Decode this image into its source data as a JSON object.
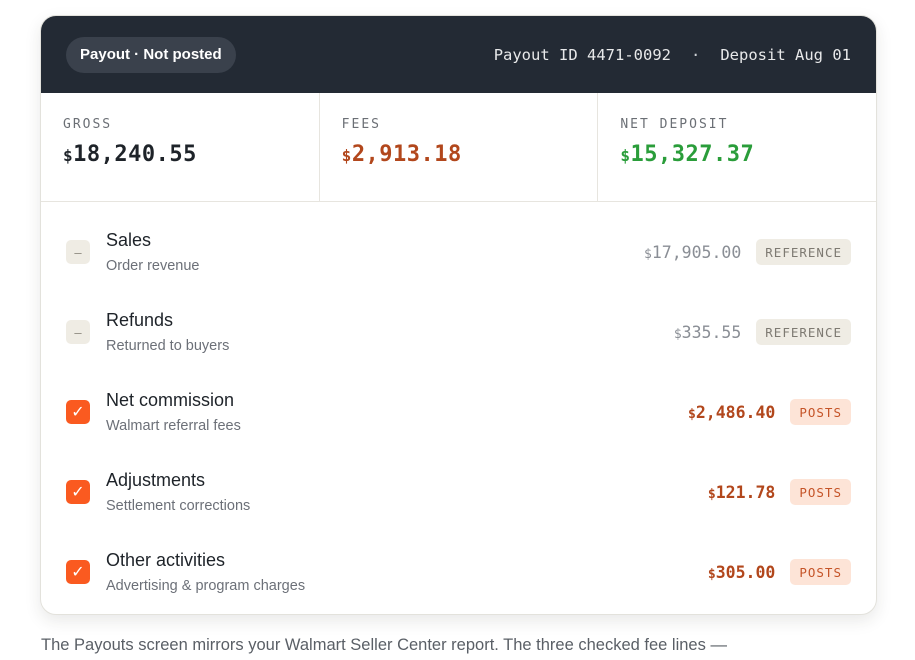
{
  "header": {
    "status": "Payout · Not posted",
    "payout_id": "Payout ID 4471-0092",
    "separator": "·",
    "deposit": "Deposit Aug 01"
  },
  "summary": [
    {
      "label": "GROSS",
      "currency": "$",
      "amount": "18,240.55",
      "color": "#1e2329"
    },
    {
      "label": "FEES",
      "currency": "$",
      "amount": "2,913.18",
      "color": "#b2471c"
    },
    {
      "label": "NET DEPOSIT",
      "currency": "$",
      "amount": "15,327.37",
      "color": "#2a9d3a"
    }
  ],
  "lines": [
    {
      "title": "Sales",
      "subtitle": "Order revenue",
      "currency": "$",
      "amount": "17,905.00",
      "tag": "REFERENCE",
      "checked": false,
      "glyph": "–"
    },
    {
      "title": "Refunds",
      "subtitle": "Returned to buyers",
      "currency": "$",
      "amount": "335.55",
      "tag": "REFERENCE",
      "checked": false,
      "glyph": "–"
    },
    {
      "title": "Net commission",
      "subtitle": "Walmart referral fees",
      "currency": "$",
      "amount": "2,486.40",
      "tag": "POSTS",
      "checked": true,
      "glyph": "✓"
    },
    {
      "title": "Adjustments",
      "subtitle": "Settlement corrections",
      "currency": "$",
      "amount": "121.78",
      "tag": "POSTS",
      "checked": true,
      "glyph": "✓"
    },
    {
      "title": "Other activities",
      "subtitle": "Advertising & program charges",
      "currency": "$",
      "amount": "305.00",
      "tag": "POSTS",
      "checked": true,
      "glyph": "✓"
    }
  ],
  "footnote": "The Payouts screen mirrors your Walmart Seller Center report. The three checked fee lines —"
}
